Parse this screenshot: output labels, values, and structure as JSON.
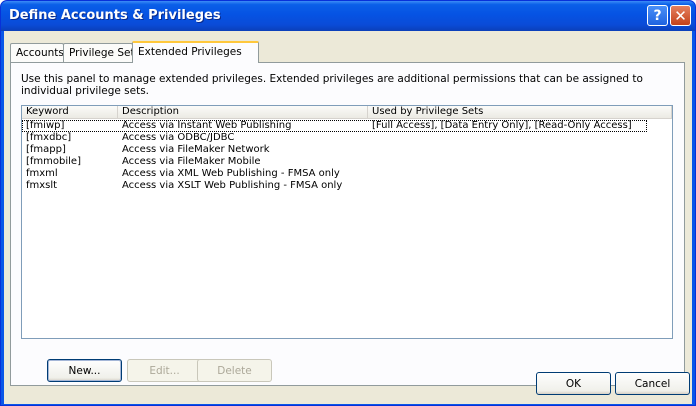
{
  "window": {
    "title": "Define Accounts & Privileges",
    "help_glyph": "?",
    "close_glyph": "✕"
  },
  "tabs": [
    {
      "label": "Accounts"
    },
    {
      "label": "Privilege Sets"
    },
    {
      "label": "Extended Privileges"
    }
  ],
  "panel": {
    "description": "Use this panel to manage extended privileges. Extended privileges are additional permissions that can be assigned to individual privilege sets."
  },
  "list": {
    "columns": [
      "Keyword",
      "Description",
      "Used by Privilege Sets"
    ],
    "rows": [
      {
        "keyword": "[fmiwp]",
        "description": "Access via Instant Web Publishing",
        "used_by": "[Full Access], [Data Entry Only], [Read-Only Access]"
      },
      {
        "keyword": "[fmxdbc]",
        "description": "Access via ODBC/JDBC",
        "used_by": ""
      },
      {
        "keyword": "[fmapp]",
        "description": "Access via FileMaker Network",
        "used_by": ""
      },
      {
        "keyword": "[fmmobile]",
        "description": "Access via FileMaker Mobile",
        "used_by": ""
      },
      {
        "keyword": "fmxml",
        "description": "Access via XML Web Publishing - FMSA only",
        "used_by": ""
      },
      {
        "keyword": "fmxslt",
        "description": "Access via XSLT Web Publishing - FMSA only",
        "used_by": ""
      }
    ]
  },
  "buttons": {
    "new": "New...",
    "edit": "Edit...",
    "delete": "Delete",
    "ok": "OK",
    "cancel": "Cancel"
  }
}
